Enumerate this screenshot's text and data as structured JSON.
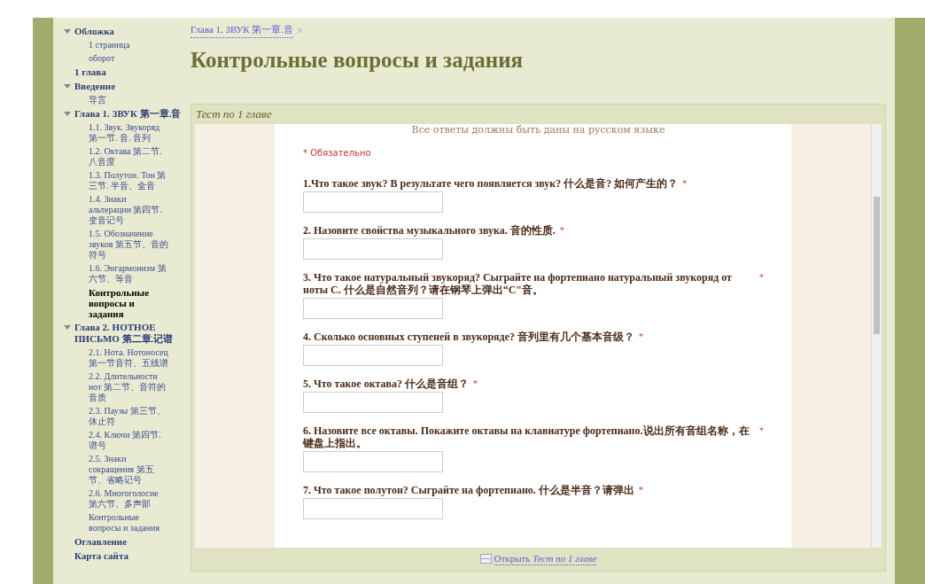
{
  "sidebar": {
    "items": [
      {
        "label": "Обложка",
        "expanded": true,
        "selected": false,
        "children": [
          {
            "label": "1 страница",
            "selected": false
          },
          {
            "label": "оборот",
            "selected": false
          }
        ]
      },
      {
        "label": "1 глава",
        "expanded": false,
        "selected": false
      },
      {
        "label": "Введение",
        "expanded": true,
        "selected": false,
        "children": [
          {
            "label": "导言",
            "selected": false
          }
        ]
      },
      {
        "label": "Глава 1. ЗВУК 第一章.音",
        "expanded": true,
        "selected": false,
        "children": [
          {
            "label": "1.1. Звук. Звукоряд 第一节. 音. 音列",
            "selected": false
          },
          {
            "label": "1.2. Октава 第二节. 八音度",
            "selected": false
          },
          {
            "label": "1.3. Полутон. Тон 第三节. 半音、全音",
            "selected": false
          },
          {
            "label": "1.4. Знаки альтерации 第四节. 变音记号",
            "selected": false
          },
          {
            "label": "1.5. Обозначение звуков 第五节、音的符号",
            "selected": false
          },
          {
            "label": "1.6. Энгармонизм 第六节、等音",
            "selected": false
          },
          {
            "label": "Контрольные вопросы и задания",
            "selected": true
          }
        ]
      },
      {
        "label": "Глава 2. НОТНОЕ ПИСЬМО 第二章.记谱",
        "expanded": true,
        "selected": false,
        "children": [
          {
            "label": "2.1. Нота. Нотоносец 第一节音符、五线谱",
            "selected": false
          },
          {
            "label": "2.2. Длительности нот 第二节、音符的音质",
            "selected": false
          },
          {
            "label": "2.3. Паузы 第三节、休止符",
            "selected": false
          },
          {
            "label": "2.4. Ключи 第四节. 谱号",
            "selected": false
          },
          {
            "label": "2.5. Знаки сокращения 第五节、省略记号",
            "selected": false
          },
          {
            "label": "2.6. Многоголосие 第六节、多声部",
            "selected": false
          },
          {
            "label": "Контрольные вопросы и задания",
            "selected": false
          }
        ]
      },
      {
        "label": "Оглавление",
        "expanded": false,
        "selected": false
      },
      {
        "label": "Карта сайта",
        "expanded": false,
        "selected": false
      }
    ]
  },
  "breadcrumb": {
    "link": "Глава 1. ЗВУК 第一章.音",
    "separator": ">"
  },
  "page_title": "Контрольные вопросы и задания",
  "embed": {
    "title": "Тест по 1 главе",
    "form": {
      "intro": "Все ответы должны быть даны на русском языке",
      "required_note": "* Обязательно",
      "required_mark": "*",
      "questions": [
        {
          "text": "1.Что такое звук? В результате чего появляется звук? 什么是音? 如何产生的？",
          "required": true
        },
        {
          "text": "2. Назовите свойства музыкального звука. 音的性质.",
          "required": true
        },
        {
          "text": "3. Что такое натуральный звукоряд? Сыграйте на фортепиано натуральный звукоряд от ноты С. 什么是自然音列？请在钢琴上弹出“C\"音。",
          "required": true
        },
        {
          "text": "4. Сколько основных ступеней в звукоряде? 音列里有几个基本音级？",
          "required": true
        },
        {
          "text": "5. Что такое октава? 什么是音组？",
          "required": true
        },
        {
          "text": "6. Назовите все октавы. Покажите октавы на клавиатуре фортепиано.说出所有音组名称，在键盘上指出。",
          "required": true
        },
        {
          "text": "7. Что такое полутон? Сыграйте на фортепиано. 什么是半音？请弹出",
          "required": true
        }
      ]
    },
    "open_link": {
      "verb": "Открыть",
      "title": "Тест по 1 главе"
    }
  }
}
